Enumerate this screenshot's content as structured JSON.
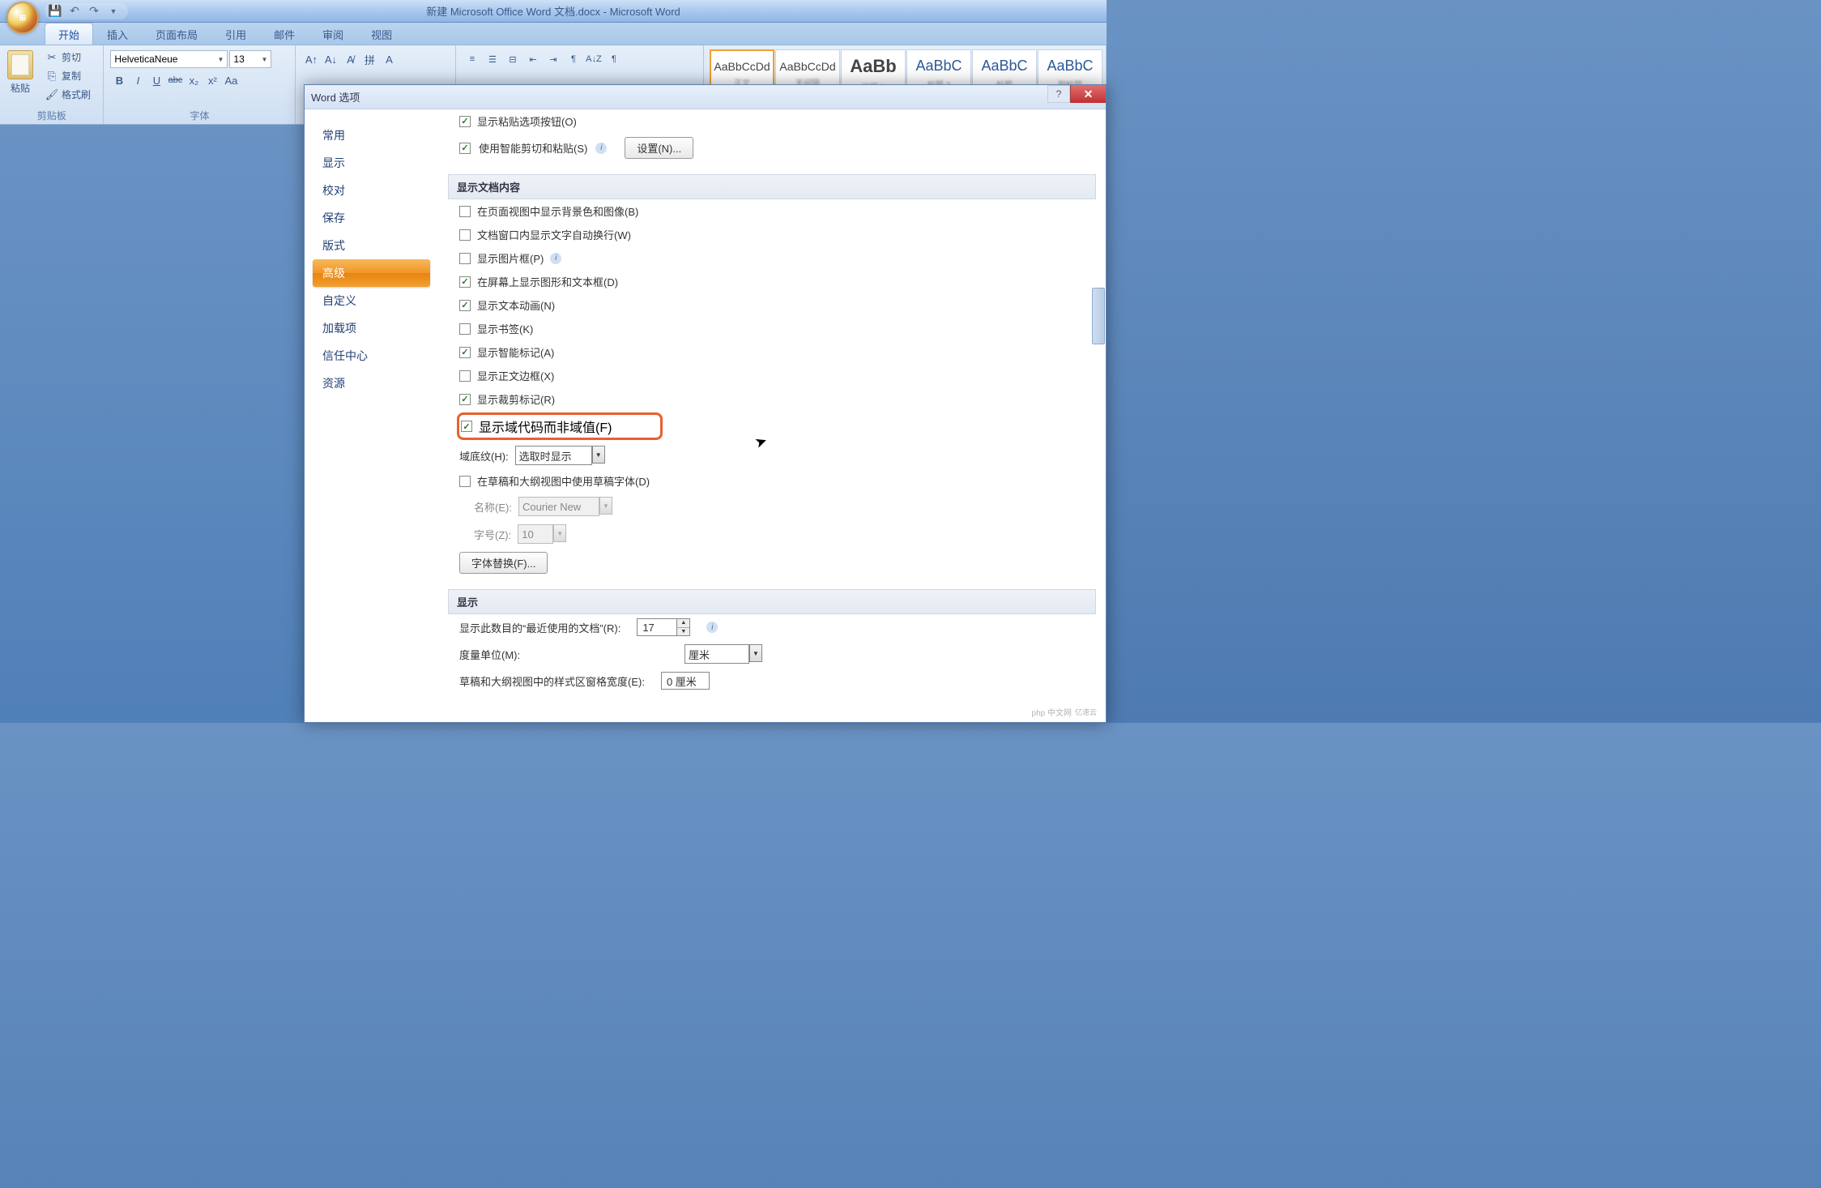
{
  "title": "新建 Microsoft Office Word 文档.docx - Microsoft Word",
  "tabs": {
    "home": "开始",
    "insert": "插入",
    "layout": "页面布局",
    "references": "引用",
    "mailings": "邮件",
    "review": "审阅",
    "view": "视图"
  },
  "clipboard": {
    "paste": "粘贴",
    "cut": "剪切",
    "copy": "复制",
    "format_painter": "格式刷",
    "group_label": "剪贴板"
  },
  "font": {
    "name": "HelveticaNeue",
    "size": "13",
    "group_label": "字体"
  },
  "styles": {
    "preview1": "AaBbCcDd",
    "preview2": "AaBbCcDd",
    "preview3": "AaBb",
    "preview4": "AaBbC",
    "preview5": "AaBbC",
    "preview6": "AaBbC"
  },
  "format_btns": {
    "bold": "B",
    "italic": "I",
    "underline": "U",
    "strike": "abc",
    "sub": "x₂",
    "sup": "x²",
    "case": "Aa"
  },
  "dialog": {
    "title": "Word 选项",
    "categories": {
      "common": "常用",
      "display": "显示",
      "proofing": "校对",
      "save": "保存",
      "layout": "版式",
      "advanced": "高级",
      "customize": "自定义",
      "addins": "加载项",
      "trust": "信任中心",
      "resources": "资源"
    },
    "top_opts": {
      "show_paste": "显示粘贴选项按钮(O)",
      "smart_cut": "使用智能剪切和粘贴(S)",
      "settings_btn": "设置(N)..."
    },
    "sec_doc_content": "显示文档内容",
    "doc_opts": {
      "bg": "在页面视图中显示背景色和图像(B)",
      "wrap": "文档窗口内显示文字自动换行(W)",
      "picframe": "显示图片框(P)",
      "drawings": "在屏幕上显示图形和文本框(D)",
      "anim": "显示文本动画(N)",
      "bookmarks": "显示书签(K)",
      "smarttags": "显示智能标记(A)",
      "textbounds": "显示正文边框(X)",
      "cropmarks": "显示裁剪标记(R)",
      "fieldcodes": "显示域代码而非域值(F)",
      "fieldshade_label": "域底纹(H):",
      "fieldshade_value": "选取时显示",
      "draftfont": "在草稿和大纲视图中使用草稿字体(D)",
      "fontname_label": "名称(E):",
      "fontname_value": "Courier New",
      "fontsize_label": "字号(Z):",
      "fontsize_value": "10",
      "fontsub_btn": "字体替换(F)..."
    },
    "sec_display": "显示",
    "display_opts": {
      "recent_label": "显示此数目的“最近使用的文档”(R):",
      "recent_value": "17",
      "units_label": "度量单位(M):",
      "units_value": "厘米",
      "stylearea_label": "草稿和大纲视图中的样式区窗格宽度(E):",
      "stylearea_value": "0 厘米"
    }
  },
  "watermark": {
    "brand": "php 中文网",
    "sub": "亿速云"
  }
}
